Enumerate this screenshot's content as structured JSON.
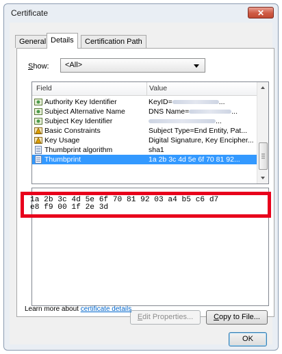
{
  "window": {
    "title": "Certificate",
    "close_glyph": "✕"
  },
  "tabs": [
    {
      "label": "General",
      "active": false
    },
    {
      "label": "Details",
      "active": true
    },
    {
      "label": "Certification Path",
      "active": false
    }
  ],
  "show": {
    "label_accel": "S",
    "label_rest": "how:",
    "selected": "<All>"
  },
  "list": {
    "headers": {
      "field": "Field",
      "value": "Value"
    },
    "rows": [
      {
        "icon": "cert-ext-icon",
        "field": "Authority Key Identifier",
        "value_prefix": "KeyID=",
        "value_suffix": "...",
        "blurred": true,
        "selected": false
      },
      {
        "icon": "cert-ext-icon",
        "field": "Subject Alternative Name",
        "value_prefix": "DNS Name=",
        "value_suffix": "...",
        "blurred": true,
        "selected": false
      },
      {
        "icon": "cert-ext-icon",
        "field": "Subject Key Identifier",
        "value_prefix": "",
        "value_suffix": "...",
        "blurred": true,
        "selected": false
      },
      {
        "icon": "critical-ext-icon",
        "field": "Basic Constraints",
        "value": "Subject Type=End Entity, Pat...",
        "selected": false
      },
      {
        "icon": "critical-ext-icon",
        "field": "Key Usage",
        "value": "Digital Signature, Key Encipher...",
        "selected": false
      },
      {
        "icon": "property-icon",
        "field": "Thumbprint algorithm",
        "value": "sha1",
        "selected": false
      },
      {
        "icon": "property-icon",
        "field": "Thumbprint",
        "value": "1a 2b 3c 4d 5e 6f 70 81 92...",
        "selected": true
      }
    ]
  },
  "detail": {
    "line1": "1a 2b 3c 4d 5e 6f 70 81 92 03 a4 b5 c6 d7",
    "line2": "e8 f9 00 1f 2e 3d"
  },
  "buttons": {
    "edit_properties_accel": "E",
    "edit_properties_rest": "dit Properties...",
    "copy_to_file_accel": "C",
    "copy_to_file_rest": "opy to File...",
    "ok": "OK"
  },
  "learn_more": {
    "prefix": "Learn more about ",
    "link": "certificate details"
  },
  "colors": {
    "selection": "#3399ff",
    "highlight_box": "#e8001c",
    "link": "#0066cc"
  }
}
